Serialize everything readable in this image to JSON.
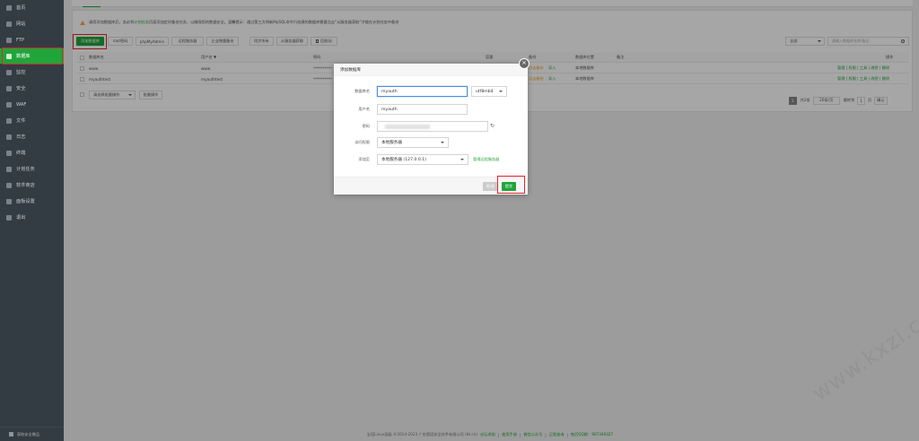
{
  "sidebar": {
    "items": [
      {
        "label": "首页",
        "icon": "home-icon"
      },
      {
        "label": "网站",
        "icon": "globe-icon"
      },
      {
        "label": "FTP",
        "icon": "ftp-icon"
      },
      {
        "label": "数据库",
        "icon": "database-icon",
        "active": true
      },
      {
        "label": "监控",
        "icon": "monitor-icon"
      },
      {
        "label": "安全",
        "icon": "shield-icon"
      },
      {
        "label": "WAF",
        "icon": "waf-icon"
      },
      {
        "label": "文件",
        "icon": "folder-icon"
      },
      {
        "label": "日志",
        "icon": "log-icon"
      },
      {
        "label": "终端",
        "icon": "terminal-icon"
      },
      {
        "label": "计划任务",
        "icon": "clock-icon"
      },
      {
        "label": "软件商店",
        "icon": "store-icon"
      },
      {
        "label": "面板设置",
        "icon": "gear-icon"
      },
      {
        "label": "退出",
        "icon": "logout-icon"
      }
    ],
    "footer": "获取安全赠品"
  },
  "alert": {
    "text_pre": "请您添加数据库后，务必到",
    "link": "计划任务",
    "text_post": "页面添加定时备份任务，以确保您的数据安全。温馨提示：通过第三方将新MySQL命令行创建的数据库需要点击“从服务器获取”才能在计划任务中备份"
  },
  "toolbar": {
    "add_db": "添加数据库",
    "root_pwd": "root密码",
    "phpmyadmin": "phpMyAdmin",
    "remote_server": "远程服务器",
    "enterprise_backup": "企业增量备份",
    "sync_all": "同步所有",
    "get_from_server": "从服务器获取",
    "recycle_bin": "回收站",
    "filter_select": "全部",
    "search_placeholder": "请输入数据库名称/备注"
  },
  "table": {
    "headers": [
      "数据库名",
      "用户名 ▼",
      "密码",
      "备份",
      "数据库位置",
      "备注",
      "操作"
    ],
    "header_capacity": "容量",
    "rows": [
      {
        "name": "www",
        "user": "www",
        "password": "**********",
        "backup_status": "点击备份",
        "import": "导入",
        "location": "本地数据库",
        "ops": "管理 | 权限 | 工具 | 改密 | 删除"
      },
      {
        "name": "myauthtest",
        "user": "myauthtest",
        "password": "**********",
        "backup_status": "点击备份",
        "import": "导入",
        "location": "本地数据库",
        "ops": "管理 | 权限 | 工具 | 改密 | 删除"
      }
    ],
    "batch_select": "请选择批量操作",
    "batch_button": "批量操作"
  },
  "pager": {
    "current": "1",
    "total": "共2条",
    "per_page": "20条/页",
    "goto_label": "跳转到",
    "goto_value": "1",
    "page_unit": "页",
    "confirm": "确认"
  },
  "dialog": {
    "title": "添加数据库",
    "fields": {
      "db_name_label": "数据库名",
      "db_name_value": "myauth",
      "charset_value": "utf8mb4",
      "username_label": "用户名",
      "username_value": "myauth",
      "password_label": "密码",
      "access_label": "访问权限",
      "access_value": "本地服务器",
      "add_to_label": "添加至",
      "add_to_value": "本地服务器 (127.0.0.1)",
      "manage_remote_link": "管理远程服务器"
    },
    "cancel": "取消",
    "submit": "提交"
  },
  "footer": {
    "copyright": "宝塔Linux面板 ©2014-2023 广东堡塔安全技术有限公司 (bt.cn)",
    "links": [
      "论坛求助",
      "使用手册",
      "微信公众号",
      "正版查询",
      "售后QQ群：907349327"
    ]
  },
  "watermark": "www.kxzi.cn",
  "colors": {
    "accent": "#20a53a",
    "sidebar_bg": "#333c42",
    "highlight": "#e0262d"
  }
}
